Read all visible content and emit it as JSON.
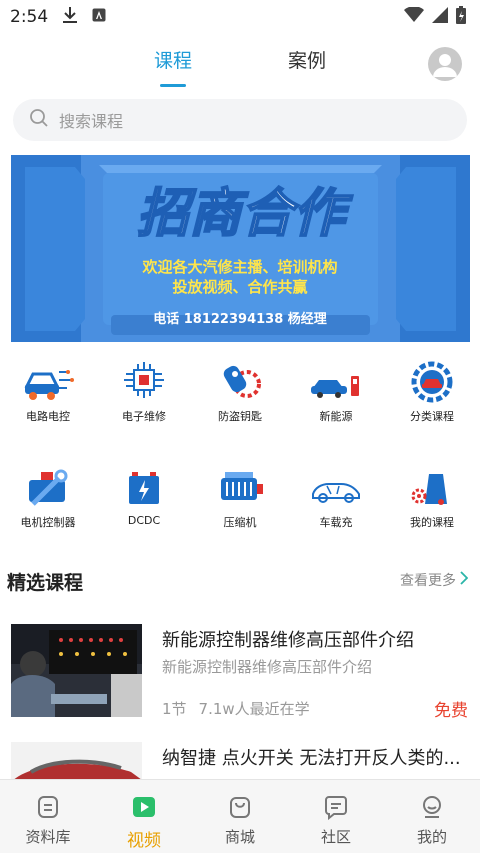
{
  "status": {
    "time": "2:54"
  },
  "tabs": [
    {
      "label": "课程"
    },
    {
      "label": "案例"
    }
  ],
  "search": {
    "placeholder": "搜索课程"
  },
  "banner": {
    "title": "招商合作",
    "line1": "欢迎各大汽修主播、培训机构",
    "line2": "投放视频、合作共赢",
    "contact": "电话 18122394138 杨经理"
  },
  "categories": [
    {
      "label": "电路电控",
      "icon": "car-circuit-icon"
    },
    {
      "label": "电子维修",
      "icon": "chip-icon"
    },
    {
      "label": "防盗钥匙",
      "icon": "key-gear-icon"
    },
    {
      "label": "新能源",
      "icon": "ev-car-icon"
    },
    {
      "label": "分类课程",
      "icon": "car-gear-icon"
    },
    {
      "label": "电机控制器",
      "icon": "motor-wrench-icon"
    },
    {
      "label": "DCDC",
      "icon": "battery-icon"
    },
    {
      "label": "压缩机",
      "icon": "engine-icon"
    },
    {
      "label": "车载充",
      "icon": "car-outline-icon"
    },
    {
      "label": "我的课程",
      "icon": "my-course-icon"
    }
  ],
  "section": {
    "title": "精选课程",
    "more": "查看更多"
  },
  "courses": [
    {
      "title": "新能源控制器维修高压部件介绍",
      "subtitle": "新能源控制器维修高压部件介绍",
      "lessons": "1节",
      "learners": "7.1w人最近在学",
      "price": "免费"
    },
    {
      "title": "纳智捷 点火开关 无法打开反人类的..."
    }
  ],
  "bottom_nav": [
    {
      "label": "资料库",
      "icon": "document-icon"
    },
    {
      "label": "视频",
      "icon": "video-icon"
    },
    {
      "label": "商城",
      "icon": "bag-icon"
    },
    {
      "label": "社区",
      "icon": "chat-icon"
    },
    {
      "label": "我的",
      "icon": "profile-icon"
    }
  ],
  "colors": {
    "accent": "#1f9bd7",
    "nav_active": "#e8a000",
    "price": "#e8432f",
    "banner_bg": "#4a90e2"
  }
}
